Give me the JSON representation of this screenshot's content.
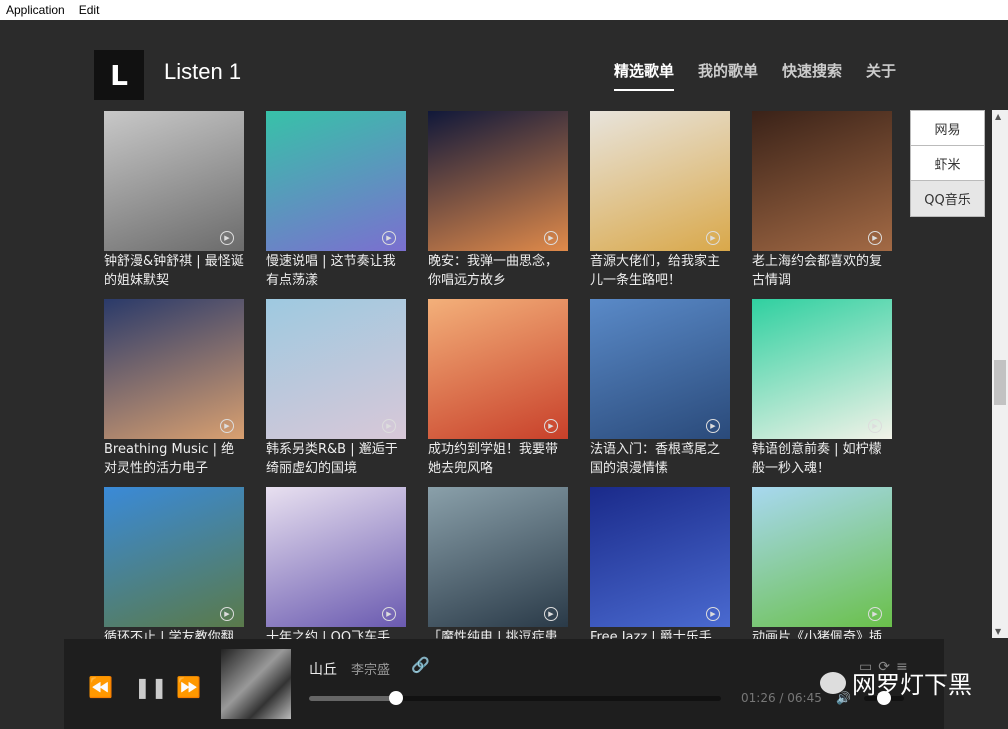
{
  "menu": [
    "Application",
    "Edit"
  ],
  "app": {
    "logo": "L",
    "title": "Listen 1"
  },
  "nav": [
    {
      "label": "精选歌单",
      "active": true
    },
    {
      "label": "我的歌单"
    },
    {
      "label": "快速搜索"
    },
    {
      "label": "关于"
    }
  ],
  "sources": [
    {
      "label": "网易"
    },
    {
      "label": "虾米"
    },
    {
      "label": "QQ音乐",
      "selected": true
    }
  ],
  "playlists": [
    {
      "title": "钟舒漫&钟舒祺 | 最怪诞的姐妹默契",
      "colors": [
        "#c8c8c8",
        "#6b6b6b"
      ]
    },
    {
      "title": "慢速说唱 | 这节奏让我有点荡漾",
      "colors": [
        "#37c2a8",
        "#7b6fd0"
      ]
    },
    {
      "title": "晚安：我弹一曲思念，你唱远方故乡",
      "colors": [
        "#10183a",
        "#e08a4a"
      ]
    },
    {
      "title": "音源大佬们，给我家主儿一条生路吧！",
      "colors": [
        "#e8e4dc",
        "#d9a84a"
      ]
    },
    {
      "title": "老上海约会都喜欢的复古情调",
      "colors": [
        "#3a2218",
        "#a36a45"
      ]
    },
    {
      "title": "Breathing Music | 绝对灵性的活力电子",
      "colors": [
        "#2a3a6a",
        "#d9a070"
      ]
    },
    {
      "title": "韩系另类R&B | 邂逅于绮丽虚幻的国境",
      "colors": [
        "#9ec9e0",
        "#d8c8d8"
      ]
    },
    {
      "title": "成功约到学姐！我要带她去兜风咯",
      "colors": [
        "#f3b07a",
        "#c8402a"
      ]
    },
    {
      "title": "法语入门：香根鸢尾之国的浪漫情愫",
      "colors": [
        "#5a8ac8",
        "#2a4a7a"
      ]
    },
    {
      "title": "韩语创意前奏 | 如柠檬般一秒入魂！",
      "colors": [
        "#2fd0a0",
        "#f2f2e8"
      ]
    },
    {
      "title": "循环不止 | 学友教你翻",
      "colors": [
        "#3a8ad8",
        "#5a7a4a"
      ]
    },
    {
      "title": "十年之约 | QQ飞车手",
      "colors": [
        "#e8e0f0",
        "#6a5ab0"
      ]
    },
    {
      "title": "「魔性纯电 | 挑逗症患",
      "colors": [
        "#8aa0aa",
        "#2a3a48"
      ]
    },
    {
      "title": "Free Jazz | 爵士乐手",
      "colors": [
        "#1a2a8a",
        "#4a6ad0"
      ]
    },
    {
      "title": "动画片《小猪佩奇》插",
      "colors": [
        "#a8d8f0",
        "#6ac04a"
      ]
    }
  ],
  "player": {
    "song": "山丘",
    "artist": "李宗盛",
    "current": "01:26",
    "total": "06:45",
    "progress": 0.21,
    "volume": 0.5
  },
  "watermark": "网罗灯下黑"
}
